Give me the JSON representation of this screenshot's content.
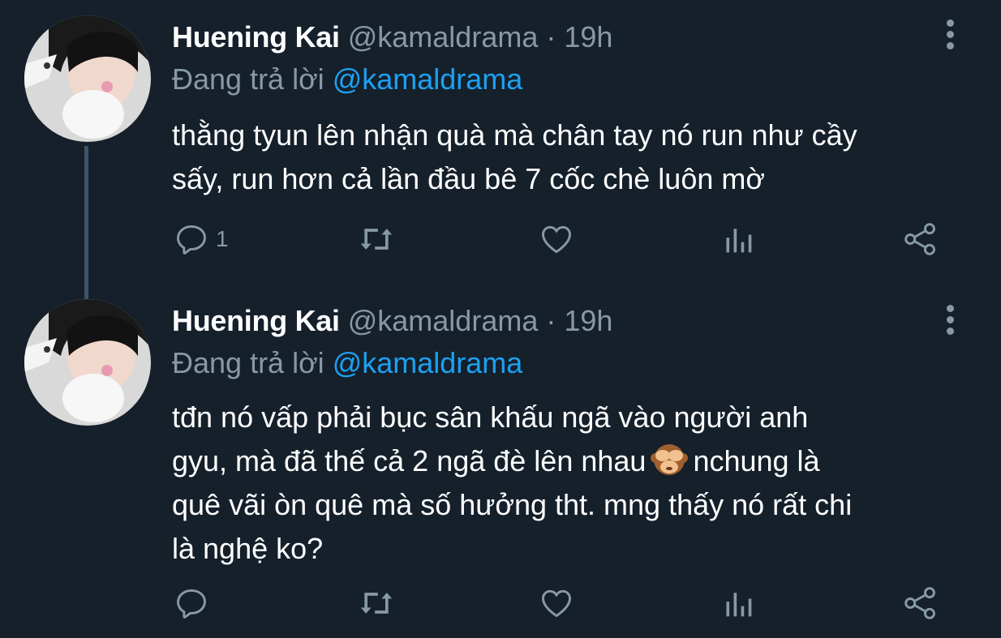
{
  "tweets": [
    {
      "name": "Huening Kai",
      "handle": "@kamaldrama",
      "separator": "·",
      "time": "19h",
      "reply_prefix": "Đang trả lời",
      "reply_to": "@kamaldrama",
      "text_lines": [
        "thằng tyun lên nhận quà mà chân tay nó run như cầy",
        "sấy, run hơn cả lần đầu bê 7 cốc chè luôn mờ"
      ],
      "reply_count": "1",
      "icons": [
        "reply-icon",
        "retweet-icon",
        "like-icon",
        "analytics-icon",
        "share-icon"
      ]
    },
    {
      "name": "Huening Kai",
      "handle": "@kamaldrama",
      "separator": "·",
      "time": "19h",
      "reply_prefix": "Đang trả lời",
      "reply_to": "@kamaldrama",
      "text_lines": [
        "tđn nó vấp phải bục sân khấu ngã vào người anh",
        "gyu, mà đã thế cả 2 ngã đè lên nhau",
        "nchung là",
        "quê vãi òn quê mà số hưởng tht. mng thấy nó rất chi",
        "là nghệ ko?"
      ],
      "emoji": "see-no-evil-monkey",
      "reply_count": "",
      "icons": [
        "reply-icon",
        "retweet-icon",
        "like-icon",
        "analytics-icon",
        "share-icon"
      ]
    }
  ],
  "colors": {
    "background": "#15202b",
    "primary_text": "#ffffff",
    "secondary_text": "#8899a6",
    "link": "#1da1f2",
    "thread_line": "#3d5466"
  }
}
